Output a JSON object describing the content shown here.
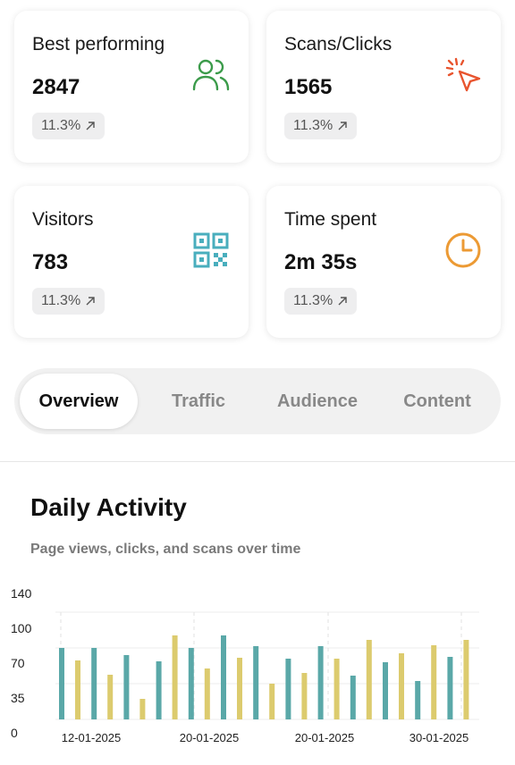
{
  "cards": [
    {
      "title": "Best performing",
      "value": "2847",
      "badge": "11.3%",
      "icon": "users-icon",
      "color": "#3b9b4a"
    },
    {
      "title": "Scans/Clicks",
      "value": "1565",
      "badge": "11.3%",
      "icon": "cursor-click-icon",
      "color": "#e8542e"
    },
    {
      "title": "Visitors",
      "value": "783",
      "badge": "11.3%",
      "icon": "qr-code-icon",
      "color": "#49aebd"
    },
    {
      "title": "Time spent",
      "value": "2m 35s",
      "badge": "11.3%",
      "icon": "clock-icon",
      "color": "#ec9a34"
    }
  ],
  "tabs": [
    "Overview",
    "Traffic",
    "Audience",
    "Content"
  ],
  "active_tab": "Overview",
  "section": {
    "title": "Daily Activity",
    "subtitle": "Page views, clicks, and scans over time"
  },
  "chart_data": {
    "type": "bar",
    "y_ticks": [
      "140",
      "100",
      "70",
      "35",
      "0"
    ],
    "ylim": [
      0,
      140
    ],
    "x_tick_labels": [
      "12-01-2025",
      "20-01-2025",
      "20-01-2025",
      "30-01-2025"
    ],
    "grid": true,
    "series": [
      {
        "color": "#5aa8a8",
        "values": [
          80,
          80,
          72,
          65,
          80,
          94,
          82,
          68,
          82,
          49,
          64,
          43,
          70
        ]
      },
      {
        "color": "#dccb6e",
        "values": [
          66,
          50,
          23,
          94,
          57,
          69,
          40,
          52,
          68,
          89,
          74,
          83,
          89
        ]
      }
    ]
  }
}
